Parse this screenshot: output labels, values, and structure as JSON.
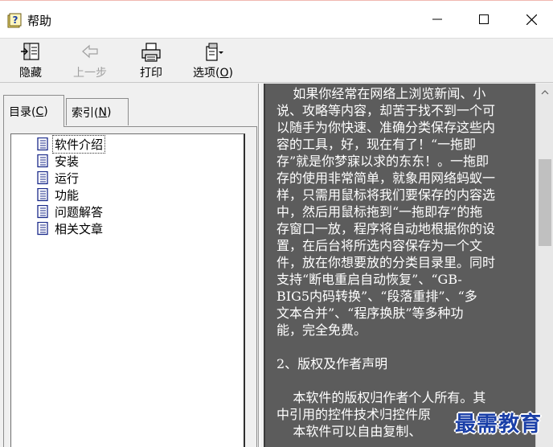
{
  "window": {
    "title": "帮助"
  },
  "toolbar": {
    "hide_label_main": "隐",
    "hide_label_rest": "藏",
    "back_label": "上一步",
    "print_label": "打印",
    "options_label_main": "选项(",
    "options_label_key": "O",
    "options_label_end": ")"
  },
  "tabs": [
    {
      "label_main": "目录(",
      "label_key": "C",
      "label_end": ")",
      "active": true
    },
    {
      "label_main": "索引(",
      "label_key": "N",
      "label_end": ")",
      "active": false
    }
  ],
  "tree": {
    "items": [
      {
        "label": "软件介绍",
        "icon": "document-icon"
      },
      {
        "label": "安装",
        "icon": "document-icon"
      },
      {
        "label": "运行",
        "icon": "document-icon"
      },
      {
        "label": "功能",
        "icon": "document-icon"
      },
      {
        "label": "问题解答",
        "icon": "document-icon"
      },
      {
        "label": "相关文章",
        "icon": "document-icon"
      }
    ]
  },
  "content": {
    "lines": [
      "    如果你经常在网络上浏览新闻、小",
      "说、攻略等内容，却苦于找不到一个可",
      "以随手为你快速、准确分类保存这些内",
      "容的工具，好，现在有了！“一拖即",
      "存”就是你梦寐以求的东东！。一拖即",
      "存的使用非常简单，就象用网络蚂蚁一",
      "样，只需用鼠标将我们要保存的内容选",
      "中，然后用鼠标拖到“一拖即存”的拖",
      "存窗口一放，程序将自动地根据你的设",
      "置，在后台将所选内容保存为一个文",
      "件，放在你想要放的分类目录里。同时",
      "支持“断电重启自动恢复”、“GB-",
      "BIG5内码转换”、“段落重排”、“多",
      "文本合并”、“程序换肤”等多种功",
      "能，完全免费。"
    ],
    "heading": "2、版权及作者声明",
    "lines2": [
      "    本软件的版权归作者个人所有。其",
      "中引用的控件技术归控件原",
      "    本软件可以自由复制、"
    ]
  },
  "watermark": "最需教育",
  "colors": {
    "content_bg": "#5c5c5c",
    "content_text": "#ffffff",
    "watermark": "#1a3fa8"
  }
}
